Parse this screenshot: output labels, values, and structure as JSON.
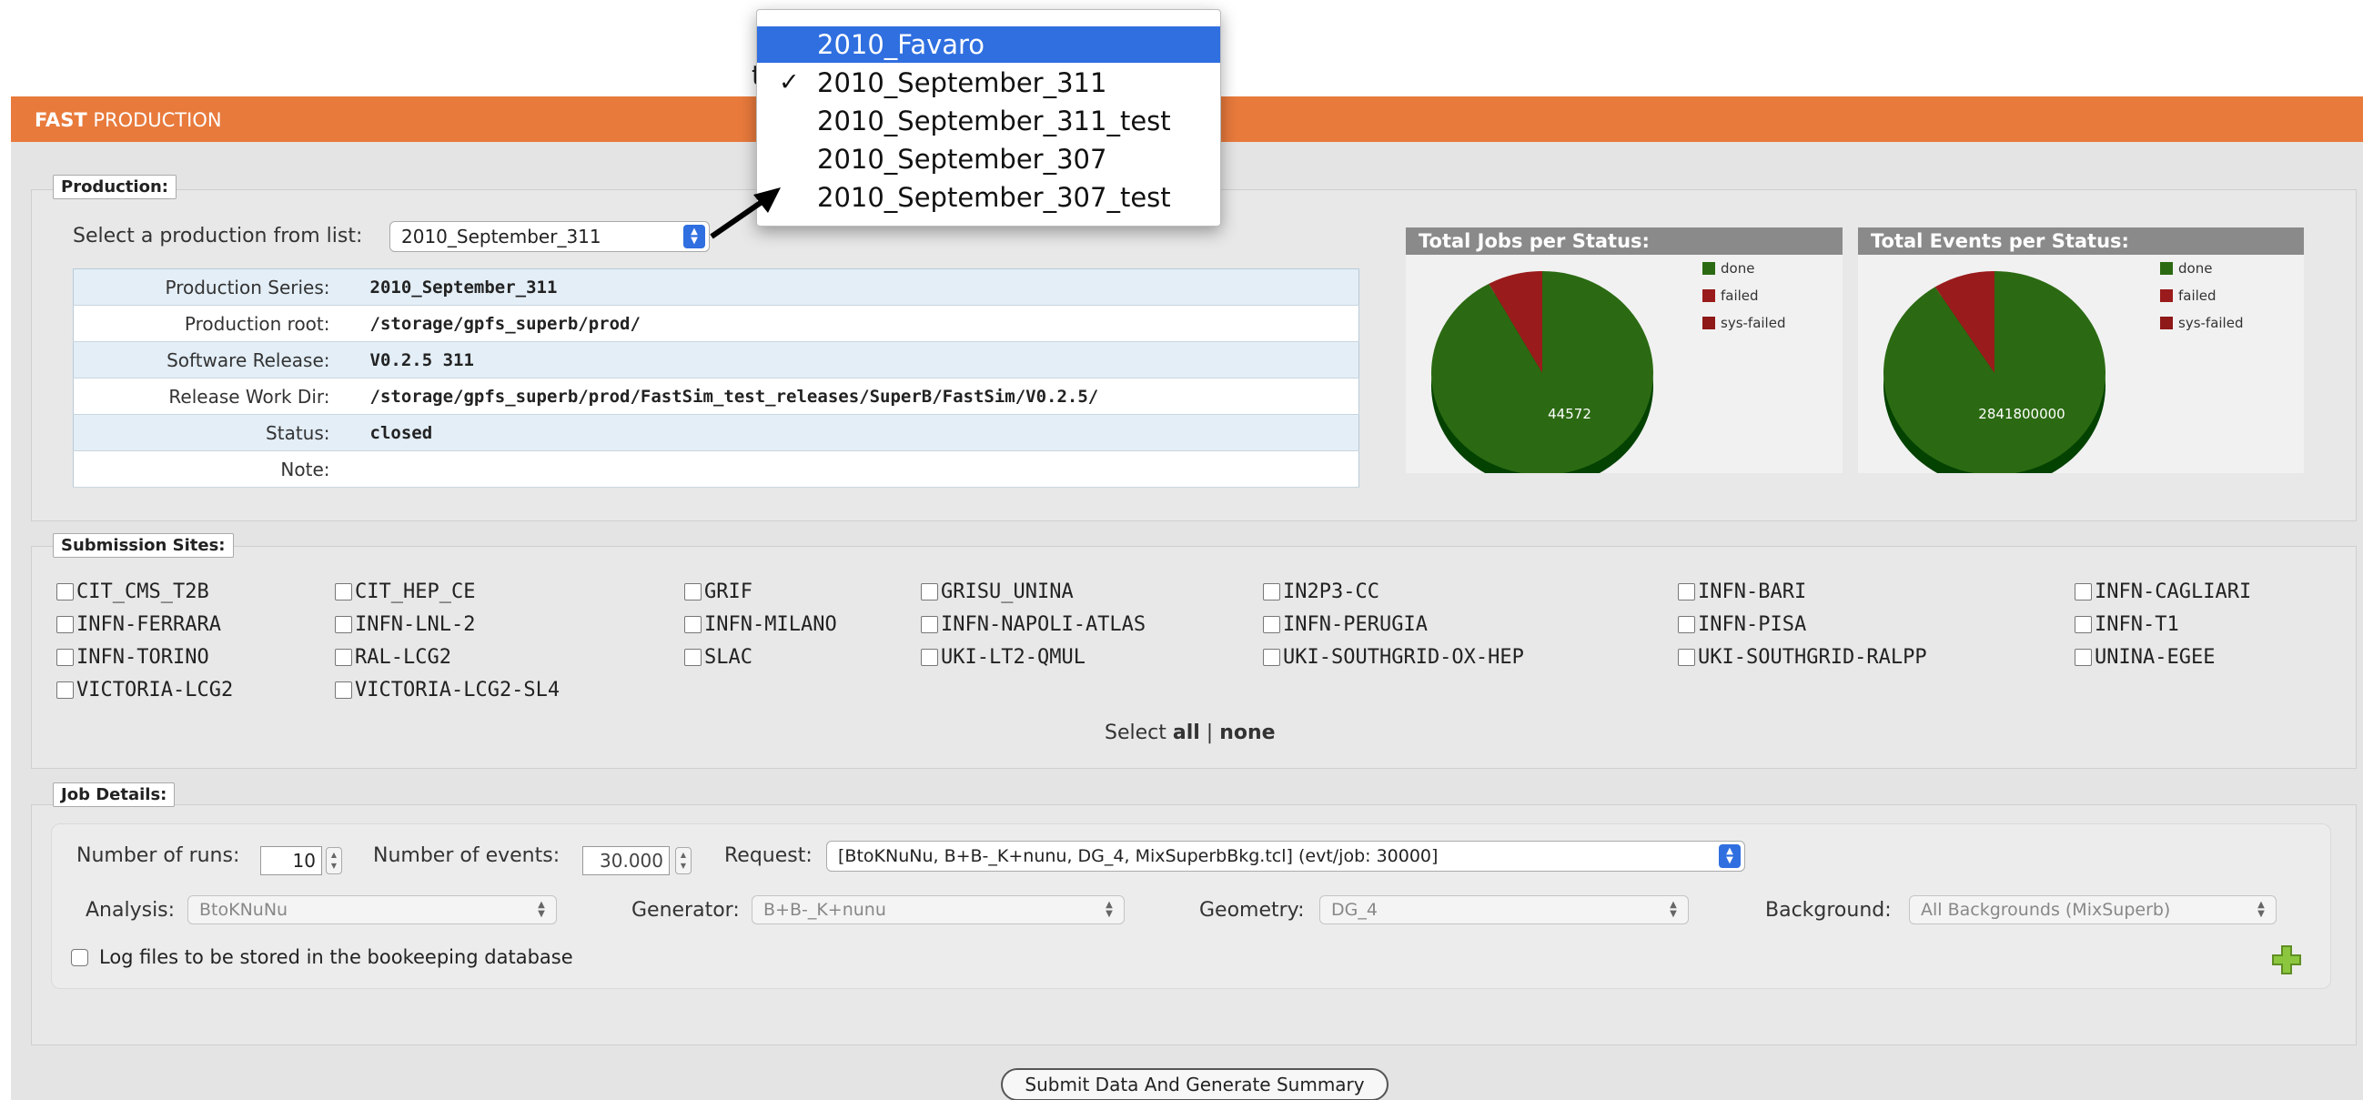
{
  "header": {
    "brand_bold": "FAST",
    "brand_rest": " PRODUCTION"
  },
  "production": {
    "legend": "Production:",
    "select_label": "Select a production from list:",
    "selected": "2010_September_311",
    "rows": [
      {
        "key": "Production Series:",
        "value": "2010_September_311"
      },
      {
        "key": "Production root:",
        "value": "/storage/gpfs_superb/prod/"
      },
      {
        "key": "Software Release:",
        "value": "V0.2.5 311"
      },
      {
        "key": "Release Work Dir:",
        "value": "/storage/gpfs_superb/prod/FastSim_test_releases/SuperB/FastSim/V0.2.5/"
      },
      {
        "key": "Status:",
        "value": "closed"
      },
      {
        "key": "Note:",
        "value": ""
      }
    ]
  },
  "dropdown": {
    "partial_hidden_char": "t",
    "items": [
      {
        "label": "2010_Favaro",
        "highlighted": true,
        "checked": false
      },
      {
        "label": "2010_September_311",
        "highlighted": false,
        "checked": true
      },
      {
        "label": "2010_September_311_test",
        "highlighted": false,
        "checked": false
      },
      {
        "label": "2010_September_307",
        "highlighted": false,
        "checked": false
      },
      {
        "label": "2010_September_307_test",
        "highlighted": false,
        "checked": false
      }
    ],
    "check_glyph": "✓"
  },
  "chart_data": [
    {
      "type": "pie",
      "title": "Total Jobs per Status:",
      "categories": [
        "done",
        "failed",
        "sys-failed"
      ],
      "values": [
        0.92,
        0.08,
        0.0
      ],
      "data_label": "44572",
      "colors": [
        "#2b6a12",
        "#9a1b1b",
        "#8f1818"
      ],
      "legend": "top-right"
    },
    {
      "type": "pie",
      "title": "Total Events per Status:",
      "categories": [
        "done",
        "failed",
        "sys-failed"
      ],
      "values": [
        0.91,
        0.09,
        0.0
      ],
      "data_label": "2841800000",
      "colors": [
        "#2b6a12",
        "#9a1b1b",
        "#8f1818"
      ],
      "legend": "top-right"
    }
  ],
  "sites": {
    "legend": "Submission Sites:",
    "columns": [
      [
        "CIT_CMS_T2B",
        "INFN-FERRARA",
        "INFN-TORINO",
        "VICTORIA-LCG2"
      ],
      [
        "CIT_HEP_CE",
        "INFN-LNL-2",
        "RAL-LCG2",
        "VICTORIA-LCG2-SL4"
      ],
      [
        "GRIF",
        "INFN-MILANO",
        "SLAC"
      ],
      [
        "GRISU_UNINA",
        "INFN-NAPOLI-ATLAS",
        "UKI-LT2-QMUL"
      ],
      [
        "IN2P3-CC",
        "INFN-PERUGIA",
        "UKI-SOUTHGRID-OX-HEP"
      ],
      [
        "INFN-BARI",
        "INFN-PISA",
        "UKI-SOUTHGRID-RALPP"
      ],
      [
        "INFN-CAGLIARI",
        "INFN-T1",
        "UNINA-EGEE"
      ]
    ],
    "select_prefix": "Select ",
    "select_all": "all",
    "separator": " | ",
    "select_none": "none"
  },
  "job": {
    "legend": "Job Details:",
    "runs_label": "Number of runs:",
    "runs_value": "10",
    "events_label": "Number of events:",
    "events_value": "30.000",
    "request_label": "Request:",
    "request_value": "[BtoKNuNu, B+B-_K+nunu, DG_4, MixSuperbBkg.tcl] (evt/job: 30000]",
    "analysis_label": "Analysis:",
    "analysis_value": "BtoKNuNu",
    "generator_label": "Generator:",
    "generator_value": "B+B-_K+nunu",
    "geometry_label": "Geometry:",
    "geometry_value": "DG_4",
    "background_label": "Background:",
    "background_value": "All Backgrounds (MixSuperb)",
    "log_label": "Log files to be stored in the bookeeping database"
  },
  "submit_label": "Submit Data And Generate Summary",
  "colors": {
    "orange": "#e87a3c",
    "select_blue": "#2f6fe0",
    "done": "#2b6a12",
    "failed": "#9a1b1b",
    "add_green": "#8cc63f"
  }
}
